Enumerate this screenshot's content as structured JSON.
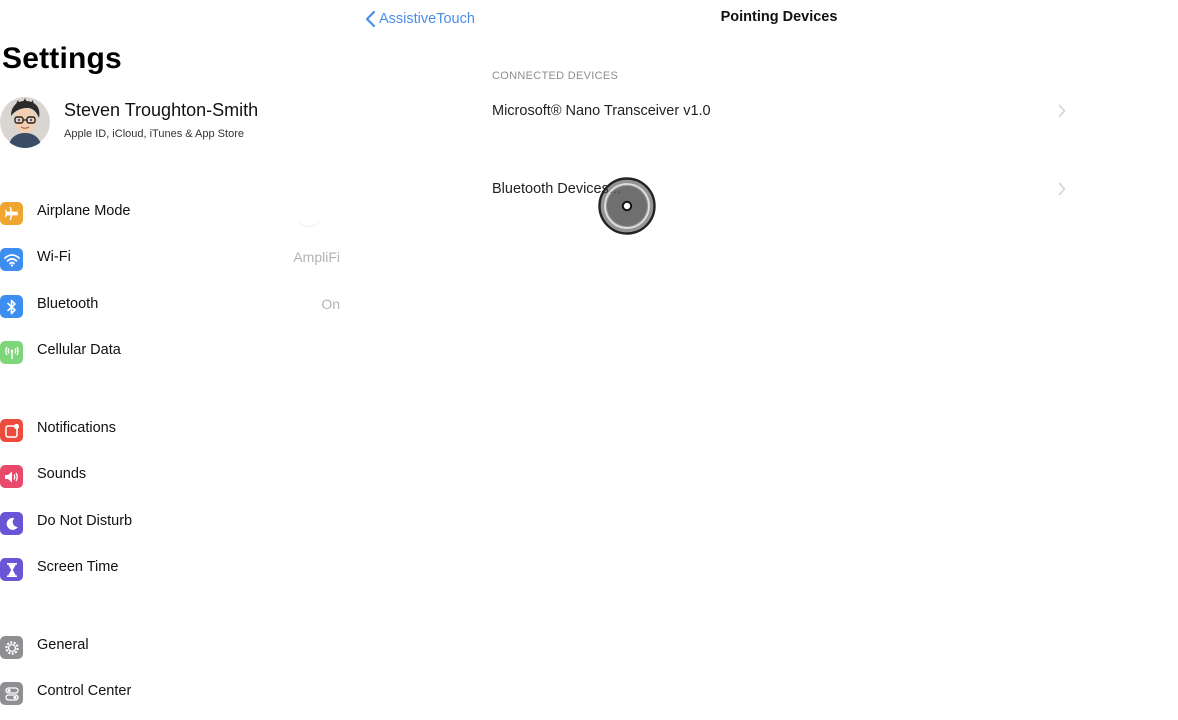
{
  "sidebar": {
    "title": "Settings",
    "profile": {
      "name": "Steven Troughton-Smith",
      "subtitle": "Apple ID, iCloud, iTunes & App Store"
    },
    "groups": [
      {
        "items": [
          {
            "label": "Airplane Mode",
            "value": "",
            "icon": "airplane-icon",
            "color": "#f0a530"
          },
          {
            "label": "Wi-Fi",
            "value": "AmpliFi",
            "icon": "wifi-icon",
            "color": "#3d8ef0"
          },
          {
            "label": "Bluetooth",
            "value": "On",
            "icon": "bluetooth-icon",
            "color": "#3d8ef0"
          },
          {
            "label": "Cellular Data",
            "value": "",
            "icon": "antenna-icon",
            "color": "#7ed67a"
          }
        ]
      },
      {
        "items": [
          {
            "label": "Notifications",
            "value": "",
            "icon": "notifications-icon",
            "color": "#ec4b3e"
          },
          {
            "label": "Sounds",
            "value": "",
            "icon": "speaker-icon",
            "color": "#e94a6c"
          },
          {
            "label": "Do Not Disturb",
            "value": "",
            "icon": "moon-icon",
            "color": "#6b55d6"
          },
          {
            "label": "Screen Time",
            "value": "",
            "icon": "hourglass-icon",
            "color": "#6b55d6"
          }
        ]
      },
      {
        "items": [
          {
            "label": "General",
            "value": "",
            "icon": "gear-icon",
            "color": "#8e8e93"
          },
          {
            "label": "Control Center",
            "value": "",
            "icon": "switches-icon",
            "color": "#8e8e93"
          }
        ]
      }
    ]
  },
  "detail": {
    "back_label": "AssistiveTouch",
    "title": "Pointing Devices",
    "section_header": "CONNECTED DEVICES",
    "rows": [
      {
        "label": "Microsoft® Nano Transceiver v1.0"
      },
      {
        "label": "Bluetooth Devices..."
      }
    ]
  },
  "colors": {
    "accent": "#4a8ee8",
    "secondary_text": "#8e8e93"
  }
}
